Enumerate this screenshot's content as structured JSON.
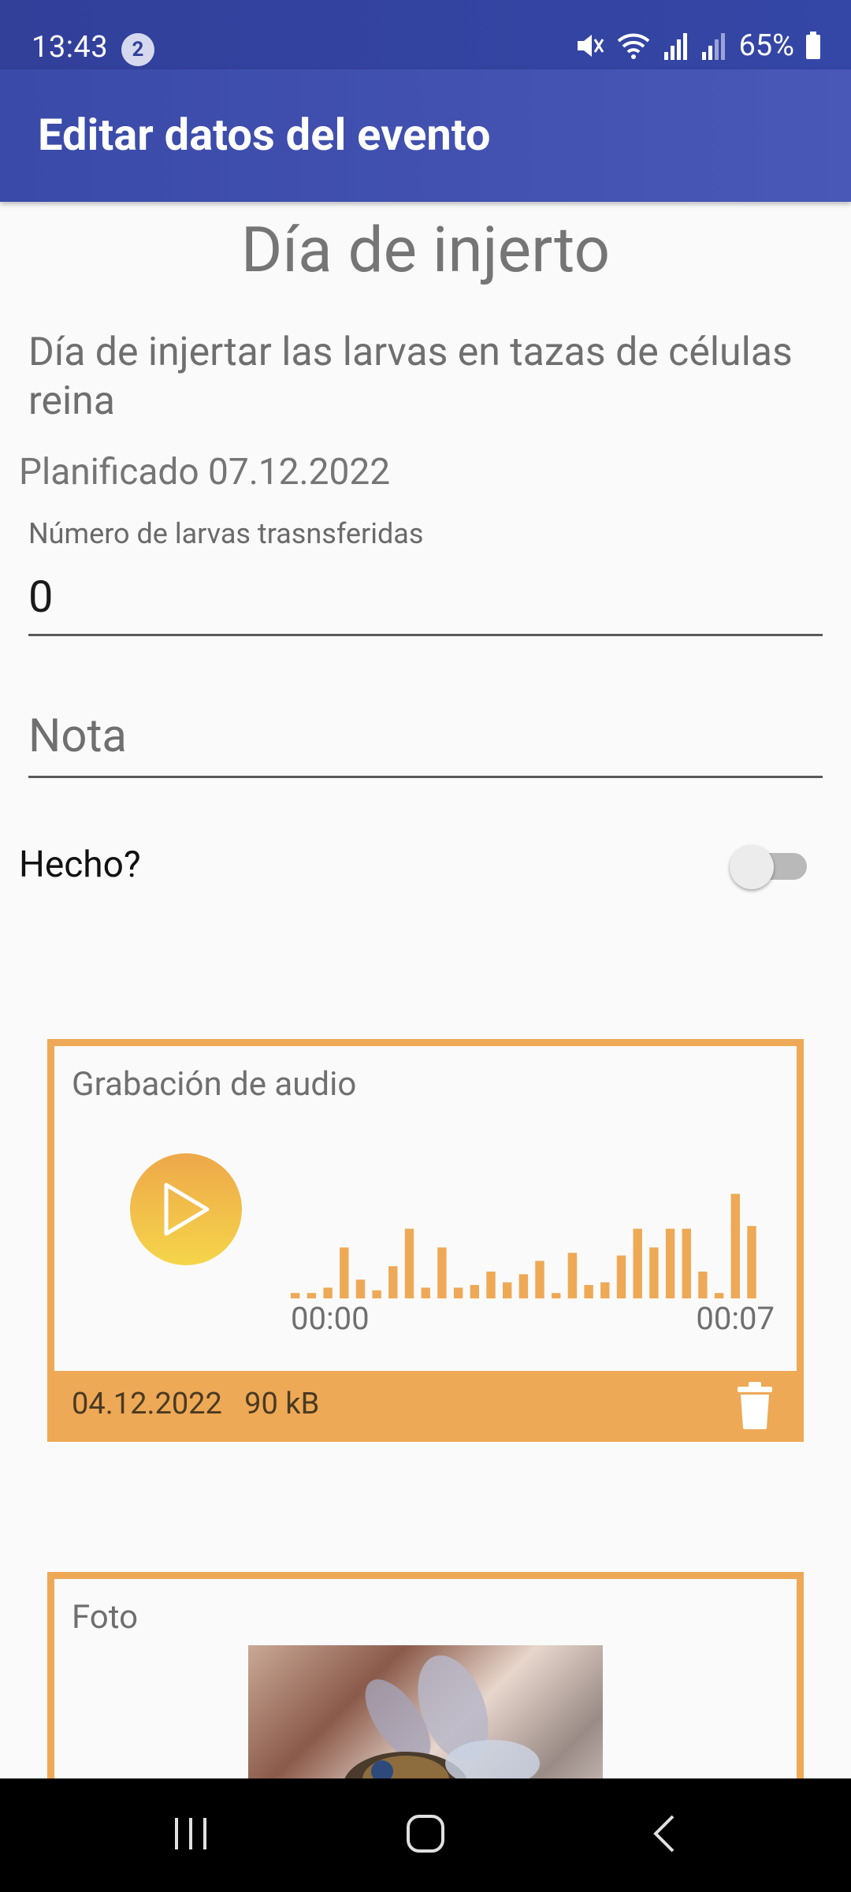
{
  "status_bar": {
    "time": "13:43",
    "notification_count": "2",
    "battery": "65%",
    "icons": [
      "mute-icon",
      "wifi-icon",
      "signal-icon",
      "signal-icon",
      "battery-icon"
    ]
  },
  "app_bar": {
    "title": "Editar datos del evento"
  },
  "event": {
    "title": "Día de injerto",
    "description": "Día de injertar las larvas en tazas de células reina",
    "planned": "Planificado 07.12.2022"
  },
  "form": {
    "larvae_label": "Número de larvas trasnsferidas",
    "larvae_value": "0",
    "note_placeholder": "Nota",
    "done_label": "Hecho?",
    "done_checked": false
  },
  "audio": {
    "title": "Grabación de audio",
    "start_time": "00:00",
    "end_time": "00:07",
    "date": "04.12.2022",
    "size": "90 kB",
    "accent_color": "#eea956",
    "waveform_levels": [
      0.04,
      0.04,
      0.08,
      0.38,
      0.14,
      0.06,
      0.24,
      0.52,
      0.08,
      0.38,
      0.08,
      0.1,
      0.2,
      0.12,
      0.18,
      0.28,
      0.04,
      0.34,
      0.1,
      0.12,
      0.32,
      0.52,
      0.38,
      0.52,
      0.52,
      0.2,
      0.04,
      0.78,
      0.54
    ]
  },
  "photo": {
    "title": "Foto"
  },
  "nav": {
    "icons": [
      "recent-apps-icon",
      "home-icon",
      "back-icon"
    ]
  }
}
